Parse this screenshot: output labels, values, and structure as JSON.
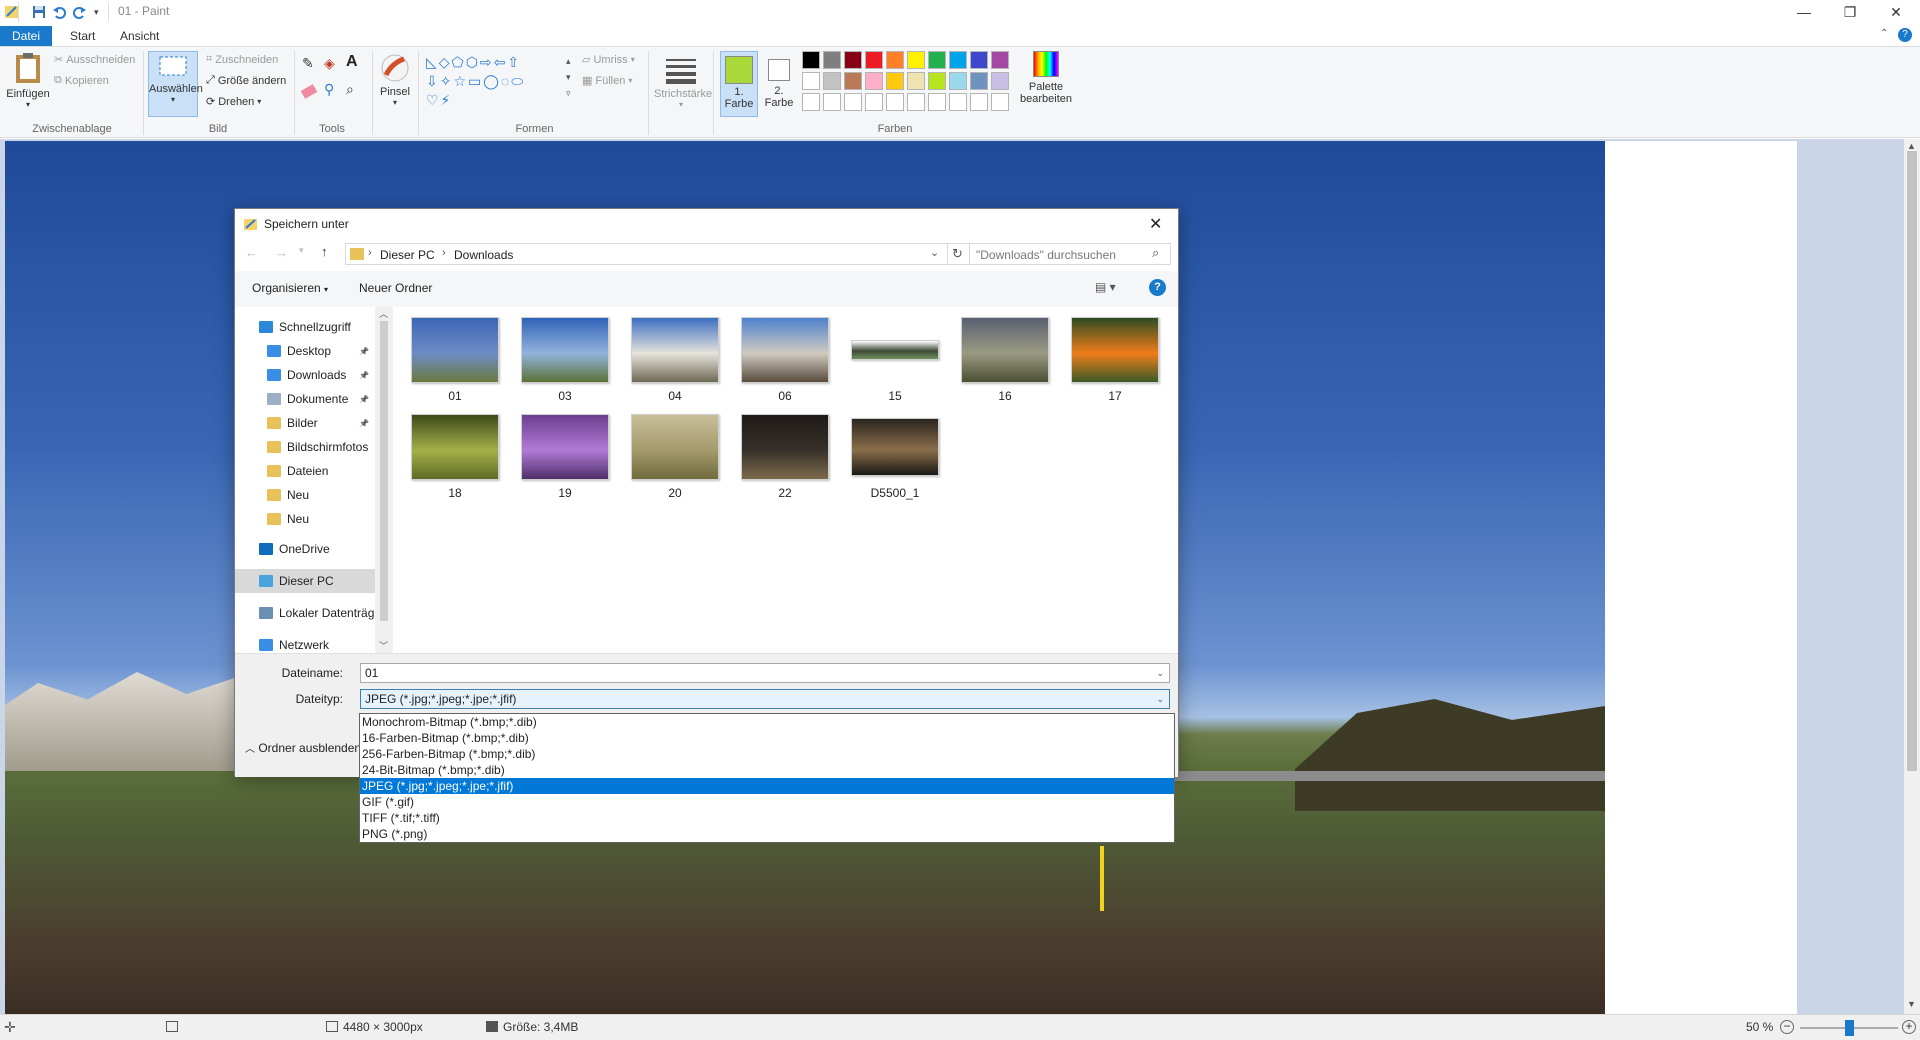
{
  "window": {
    "title": "01 - Paint",
    "controls": [
      "minimize",
      "restore",
      "close"
    ]
  },
  "ribbon": {
    "tabs": [
      {
        "label": "Datei",
        "active": true
      },
      {
        "label": "Start"
      },
      {
        "label": "Ansicht"
      }
    ],
    "clipboard": {
      "paste": "Einfügen",
      "cut": "Ausschneiden",
      "copy": "Kopieren",
      "group": "Zwischenablage"
    },
    "image": {
      "select": "Auswählen",
      "crop": "Zuschneiden",
      "resize": "Größe ändern",
      "rotate": "Drehen",
      "group": "Bild"
    },
    "tools": {
      "group": "Tools"
    },
    "brushes": {
      "label": "Pinsel"
    },
    "shapes": {
      "outline": "Umriss",
      "fill": "Füllen",
      "group": "Formen"
    },
    "size": {
      "label": "Strichstärke"
    },
    "colors": {
      "color1_line1": "1.",
      "color1_line2": "Farbe",
      "color2_line1": "2.",
      "color2_line2": "Farbe",
      "edit_line1": "Palette",
      "edit_line2": "bearbeiten",
      "group": "Farben",
      "color1": "#a8d83a",
      "color2": "#ffffff",
      "palette_row1": [
        "#000000",
        "#7f7f7f",
        "#880015",
        "#ed1c24",
        "#ff7f27",
        "#fff200",
        "#22b14c",
        "#00a2e8",
        "#3f48cc",
        "#a349a4"
      ],
      "palette_row2": [
        "#ffffff",
        "#c3c3c3",
        "#b97a57",
        "#ffaec9",
        "#ffc90e",
        "#efe4b0",
        "#b5e61d",
        "#99d9ea",
        "#7092be",
        "#c8bfe7"
      ]
    }
  },
  "dialog": {
    "title": "Speichern unter",
    "breadcrumb": [
      "Dieser PC",
      "Downloads"
    ],
    "search_placeholder": "\"Downloads\" durchsuchen",
    "organize": "Organisieren",
    "new_folder": "Neuer Ordner",
    "nav": [
      {
        "label": "Schnellzugriff",
        "icon": "star-icon",
        "color": "#2b88d8",
        "indent": 0,
        "pinned": false
      },
      {
        "label": "Desktop",
        "icon": "desktop-icon",
        "color": "#3a8ee6",
        "indent": 1,
        "pinned": true
      },
      {
        "label": "Downloads",
        "icon": "download-folder-icon",
        "color": "#3a8ee6",
        "indent": 1,
        "pinned": true
      },
      {
        "label": "Dokumente",
        "icon": "documents-icon",
        "color": "#9bb0c7",
        "indent": 1,
        "pinned": true
      },
      {
        "label": "Bilder",
        "icon": "pictures-folder-icon",
        "color": "#e8c15a",
        "indent": 1,
        "pinned": true
      },
      {
        "label": "Bildschirmfotos",
        "icon": "folder-icon",
        "color": "#e8c15a",
        "indent": 1,
        "pinned": false
      },
      {
        "label": "Dateien",
        "icon": "folder-icon",
        "color": "#e8c15a",
        "indent": 1,
        "pinned": false
      },
      {
        "label": "Neu",
        "icon": "folder-icon",
        "color": "#e8c15a",
        "indent": 1,
        "pinned": false
      },
      {
        "label": "Neu",
        "icon": "folder-icon",
        "color": "#e8c15a",
        "indent": 1,
        "pinned": false
      },
      {
        "label": "OneDrive",
        "icon": "cloud-icon",
        "color": "#0f6cbd",
        "indent": 0,
        "pinned": false
      },
      {
        "label": "Dieser PC",
        "icon": "computer-icon",
        "color": "#4aa3df",
        "indent": 0,
        "pinned": false,
        "selected": true
      },
      {
        "label": "Lokaler Datenträg",
        "icon": "drive-icon",
        "color": "#6b8fb0",
        "indent": 0,
        "pinned": false
      },
      {
        "label": "Netzwerk",
        "icon": "network-icon",
        "color": "#3a8ee6",
        "indent": 0,
        "pinned": false
      }
    ],
    "files": [
      {
        "name": "01",
        "colors": [
          "#3b66b6",
          "#6d8cc6",
          "#6b7a40"
        ]
      },
      {
        "name": "03",
        "colors": [
          "#2f63b8",
          "#93b3dc",
          "#5a7238"
        ]
      },
      {
        "name": "04",
        "colors": [
          "#3b6fc1",
          "#e6e3dc",
          "#6f6a56"
        ]
      },
      {
        "name": "06",
        "colors": [
          "#4f82cf",
          "#cfcac0",
          "#594c3d"
        ]
      },
      {
        "name": "15",
        "colors": [
          "#ffffff",
          "#3f4a36",
          "#6f8f5d"
        ]
      },
      {
        "name": "16",
        "colors": [
          "#5a6071",
          "#9a9a82",
          "#4b4f32"
        ]
      },
      {
        "name": "17",
        "colors": [
          "#2e4b22",
          "#f07d1b",
          "#3a5a25"
        ]
      },
      {
        "name": "18",
        "colors": [
          "#3c4a1a",
          "#a6b04a",
          "#5d6b24"
        ]
      },
      {
        "name": "19",
        "colors": [
          "#6b3f8f",
          "#b17ad6",
          "#4e2f6b"
        ]
      },
      {
        "name": "20",
        "colors": [
          "#c8bf9a",
          "#a59a6b",
          "#6f6a3c"
        ]
      },
      {
        "name": "22",
        "colors": [
          "#1f1a17",
          "#37302a",
          "#7d6a4c"
        ]
      },
      {
        "name": "D5500_1",
        "colors": [
          "#2a2520",
          "#8a6e4a",
          "#1c1916"
        ]
      }
    ],
    "filename_label": "Dateiname:",
    "filename_value": "01",
    "filetype_label": "Dateityp:",
    "filetype_value": "JPEG (*.jpg;*.jpeg;*.jpe;*.jfif)",
    "hide_folders": "Ordner ausblenden",
    "filetype_options": [
      "Monochrom-Bitmap (*.bmp;*.dib)",
      "16-Farben-Bitmap (*.bmp;*.dib)",
      "256-Farben-Bitmap (*.bmp;*.dib)",
      "24-Bit-Bitmap (*.bmp;*.dib)",
      "JPEG (*.jpg;*.jpeg;*.jpe;*.jfif)",
      "GIF (*.gif)",
      "TIFF (*.tif;*.tiff)",
      "PNG (*.png)"
    ],
    "selected_option_index": 4
  },
  "status": {
    "dimensions": "4480 × 3000px",
    "size": "Größe: 3,4MB",
    "zoom": "50 %",
    "zoom_fraction": 0.5
  }
}
